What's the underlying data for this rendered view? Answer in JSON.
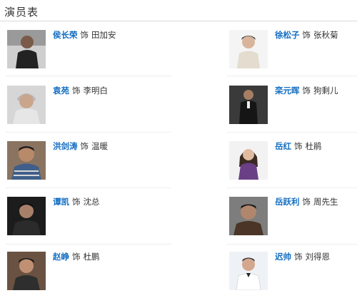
{
  "header": {
    "title": "演员表"
  },
  "connector": "饰",
  "cast": [
    {
      "actor": "侯长荣",
      "role": "田加安"
    },
    {
      "actor": "徐松子",
      "role": "张秋菊"
    },
    {
      "actor": "袁苑",
      "role": "李明白"
    },
    {
      "actor": "栾元晖",
      "role": "狗剩儿"
    },
    {
      "actor": "洪剑涛",
      "role": "温暖"
    },
    {
      "actor": "岳红",
      "role": "杜鹃"
    },
    {
      "actor": "谭凯",
      "role": "沈总"
    },
    {
      "actor": "岳跃利",
      "role": "周先生"
    },
    {
      "actor": "赵峥",
      "role": "杜鹏"
    },
    {
      "actor": "迟帅",
      "role": "刘得恩"
    }
  ]
}
